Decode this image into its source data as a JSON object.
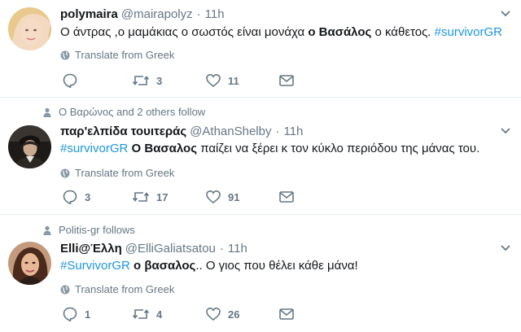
{
  "tweets": [
    {
      "context": "",
      "name": "polymaira",
      "handle": "@mairapolyz",
      "sep": "·",
      "time": "11h",
      "text": {
        "p1": "Ο άντρας ,ο μαμάκιας ο σωστός είναι μονάχα ",
        "bold": "ο Βασάλος",
        "p2": " ο κάθετος. ",
        "tag": "#survivorGR"
      },
      "translate": "Translate from Greek",
      "replies": "",
      "retweets": "3",
      "likes": "11"
    },
    {
      "context": "Ο Βαρώνος and 2 others follow",
      "name": "παρ'ελπίδα τουιτεράς",
      "handle": "@AthanShelby",
      "sep": "·",
      "time": "11h",
      "text": {
        "tag": "#survivorGR",
        "bold": "Ο Βασαλος",
        "p2": " παίζει να ξέρει κ τον κύκλο περιόδου της μάνας του."
      },
      "translate": "Translate from Greek",
      "replies": "3",
      "retweets": "17",
      "likes": "91"
    },
    {
      "context": "Politis-gr follows",
      "name": "Elli@Έλλη",
      "handle": "@ElliGaliatsatou",
      "sep": "·",
      "time": "11h",
      "text": {
        "tag": "#SurvivorGR",
        "bold": "ο βασαλος",
        "p2": ".. Ο γιος που θέλει κάθε μάνα!"
      },
      "translate": "Translate from Greek",
      "replies": "1",
      "retweets": "4",
      "likes": "26"
    }
  ],
  "icons": {
    "person": "person-icon",
    "globe": "globe-icon",
    "reply": "reply-icon",
    "retweet": "retweet-icon",
    "like": "heart-icon",
    "message": "direct-message-icon",
    "caret": "chevron-down-icon"
  },
  "colors": {
    "hashtag": "#1b95e0",
    "muted": "#657786",
    "text": "#14171a",
    "divider": "#e6ecf0"
  }
}
